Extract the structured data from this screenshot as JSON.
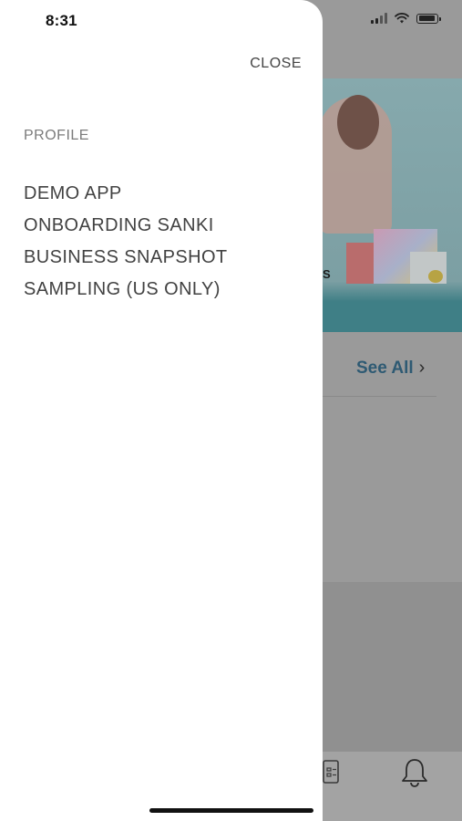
{
  "status_bar": {
    "time": "8:31"
  },
  "drawer": {
    "close_label": "CLOSE",
    "section_label": "PROFILE",
    "menu_items": [
      {
        "label": "DEMO APP"
      },
      {
        "label": "ONBOARDING SANKI"
      },
      {
        "label": "BUSINESS SNAPSHOT"
      },
      {
        "label": "SAMPLING (US ONLY)"
      }
    ]
  },
  "background": {
    "banner_fragment": "S",
    "see_all_label": "See All",
    "see_all_chevron": "›",
    "tab_icons": [
      "clipboard-icon",
      "bell-icon"
    ]
  },
  "colors": {
    "drawer_bg": "#ffffff",
    "menu_text": "#424242",
    "muted_text": "#7b7b7b",
    "overlay": "#9a9a9a",
    "accent_link": "#2e5a73"
  }
}
